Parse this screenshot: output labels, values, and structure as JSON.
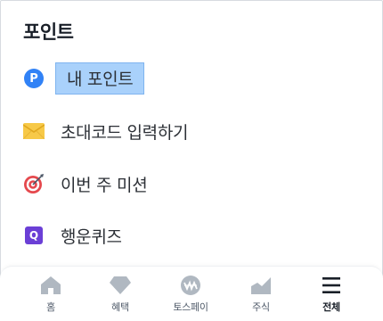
{
  "section": {
    "title": "포인트"
  },
  "menu": {
    "items": [
      {
        "label": "내 포인트",
        "icon": "points-p-icon",
        "selected": true
      },
      {
        "label": "초대코드 입력하기",
        "icon": "envelope-icon"
      },
      {
        "label": "이번 주 미션",
        "icon": "dart-target-icon"
      },
      {
        "label": "행운퀴즈",
        "icon": "quiz-q-icon"
      }
    ],
    "points_badge_letter": "P",
    "quiz_badge_letter": "Q"
  },
  "tabbar": {
    "tabs": [
      {
        "label": "홈",
        "icon": "home-icon"
      },
      {
        "label": "혜택",
        "icon": "diamond-icon"
      },
      {
        "label": "토스페이",
        "icon": "toss-pay-icon"
      },
      {
        "label": "주식",
        "icon": "stock-chart-icon"
      },
      {
        "label": "전체",
        "icon": "menu-lines-icon",
        "active": true
      }
    ]
  },
  "colors": {
    "accent_blue": "#3182f6",
    "selection_bg": "#a9d1fb",
    "quiz_purple": "#6b3fd6",
    "envelope_yellow": "#f7c948",
    "target_red": "#e5484d",
    "tab_icon_gray": "#b0b8c1"
  }
}
